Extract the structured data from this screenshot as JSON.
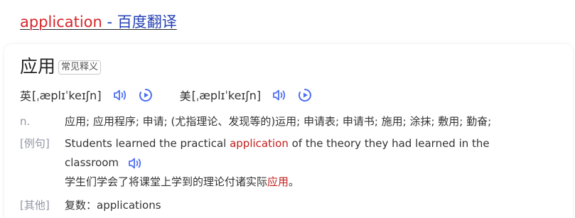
{
  "result": {
    "keyword": "application",
    "rest": " - 百度翻译"
  },
  "entry": {
    "headword": "应用",
    "tag": "常见释义"
  },
  "pronunciation": {
    "uk_label": "英",
    "uk_phonetic": "[ˌæplɪˈkeɪʃn]",
    "us_label": "美",
    "us_phonetic": "[ˌæplɪˈkeɪʃn]"
  },
  "definition": {
    "pos": "n.",
    "text": "应用; 应用程序; 申请; (尤指理论、发现等的)运用; 申请表; 申请书; 施用; 涂抹; 敷用; 勤奋;"
  },
  "example": {
    "label": "[例句]",
    "en_before": "Students learned the practical ",
    "en_highlight": "application",
    "en_after": " of the theory they had learned in the",
    "en_line2": "classroom",
    "zh_before": "学生们学会了将课堂上学到的理论付诸实际",
    "zh_highlight": "应用",
    "zh_after": "。"
  },
  "other": {
    "label": "[其他]",
    "text": "复数：applications"
  },
  "colors": {
    "keyword": "#d9252b",
    "link": "#2440b3",
    "icon": "#4e6ef2",
    "label_gray": "#9195a3",
    "highlight": "#c51d1d"
  },
  "icons": [
    "speaker-icon",
    "play-circle-icon"
  ]
}
